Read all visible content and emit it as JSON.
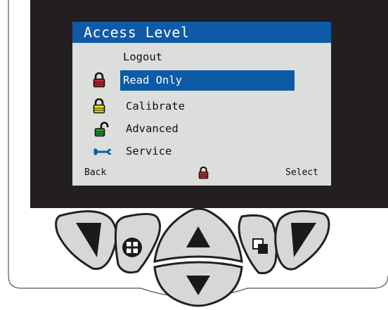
{
  "screen": {
    "title": "Access Level",
    "items": [
      {
        "label": "Logout",
        "icon": "none",
        "selected": false
      },
      {
        "label": "Read Only",
        "icon": "lock-closed-red-icon",
        "selected": true
      },
      {
        "label": "Calibrate",
        "icon": "lock-closed-yellow-icon",
        "selected": false
      },
      {
        "label": "Advanced",
        "icon": "lock-open-green-icon",
        "selected": false
      },
      {
        "label": "Service",
        "icon": "wrench-blue-icon",
        "selected": false
      }
    ],
    "softkeys": {
      "left": "Back",
      "right": "Select",
      "center_icon": "lock-closed-red-icon"
    }
  },
  "colors": {
    "bezel": "#231f20",
    "screen_bg": "#dcdedb",
    "accent": "#0e5aa7",
    "lock_red": "#d5212b",
    "lock_yellow": "#f2e313",
    "lock_green": "#2f9d3a",
    "button_fill": "#d7d7d6"
  },
  "keypad": {
    "buttons": [
      "left-softkey-button",
      "menu-grid-button",
      "up-arrow-button",
      "down-arrow-button",
      "window-switch-button",
      "right-softkey-button"
    ]
  }
}
